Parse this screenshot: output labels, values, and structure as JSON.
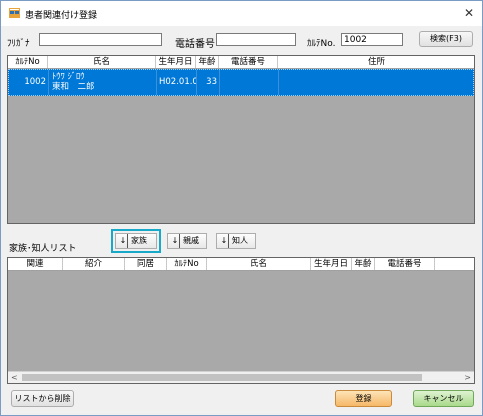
{
  "window": {
    "title": "患者関連付け登録",
    "close_icon": "close-icon"
  },
  "search": {
    "furigana_label": "ﾌﾘｶﾞﾅ",
    "furigana_value": "",
    "phone_label": "電話番号",
    "phone_value": "",
    "karte_label": "ｶﾙﾃNo.",
    "karte_value": "1002",
    "search_button": "検索(F3)"
  },
  "patient_grid": {
    "columns": [
      "ｶﾙﾃNo",
      "氏名",
      "生年月日",
      "年齢",
      "電話番号",
      "住所"
    ],
    "rows": [
      {
        "karte_no": "1002",
        "kana": "ﾄｳﾜ ｼﾞﾛｳ",
        "name": "東和　二郎",
        "birth": "H02.01.0",
        "age": "33",
        "phone": "",
        "address": ""
      }
    ]
  },
  "relation": {
    "list_label": "家族･知人リスト",
    "family_button": "家族",
    "relative_button": "親戚",
    "acquaintance_button": "知人",
    "arrow_glyph": "↓",
    "highlight_color": "#17a9c7"
  },
  "relation_grid": {
    "columns": [
      "関連",
      "紹介",
      "同居",
      "ｶﾙﾃNo",
      "氏名",
      "生年月日",
      "年齢",
      "電話番号"
    ],
    "scroll_left": "<",
    "scroll_right": ">"
  },
  "footer": {
    "delete_button": "リストから削除",
    "register_button": "登録",
    "cancel_button": "キャンセル"
  }
}
